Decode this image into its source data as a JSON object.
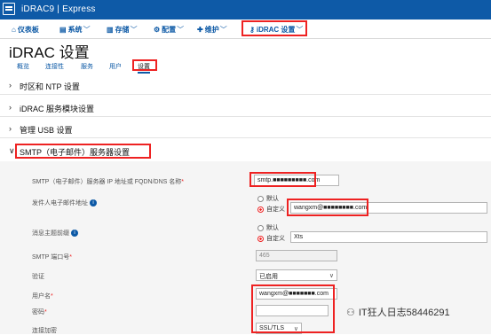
{
  "app": {
    "brand": "iDRAC9 | Express"
  },
  "nav": {
    "dashboard": {
      "label": "仪表板",
      "icon": "home-icon"
    },
    "system": {
      "label": "系统",
      "icon": "server-icon"
    },
    "storage": {
      "label": "存储",
      "icon": "database-icon"
    },
    "config": {
      "label": "配置",
      "icon": "wrench-icon"
    },
    "maintenance": {
      "label": "维护",
      "icon": "tools-icon"
    },
    "idrac_settings": {
      "label": "iDRAC 设置",
      "icon": "key-icon"
    }
  },
  "page": {
    "title": "iDRAC 设置"
  },
  "tabs": {
    "overview": "概览",
    "connectivity": "连接性",
    "services": "服务",
    "users": "用户",
    "settings": "设置"
  },
  "sections": {
    "time": "时区和 NTP 设置",
    "service_module": "iDRAC 服务模块设置",
    "usb": "管理 USB 设置",
    "smtp": "SMTP（电子邮件）服务器设置"
  },
  "form": {
    "smtp_server_label": "SMTP（电子邮件）服务器 IP 地址或 FQDN/DNS 名称",
    "smtp_server_value": "smtp.■■■■■■■■■.com",
    "sender_label": "发件人电子邮件地址",
    "sender_default": "默认",
    "sender_custom": "自定义",
    "sender_value": "wangxm@■■■■■■■■.com",
    "subject_label": "消息主题前缀",
    "subject_default": "默认",
    "subject_custom": "自定义",
    "subject_value": "Xts",
    "port_label": "SMTP 端口号",
    "port_value": "465",
    "auth_label": "验证",
    "auth_value": "已启用",
    "username_label": "用户名",
    "username_value": "wangxm@■■■■■■■.com",
    "password_label": "密码",
    "password_value": "",
    "encryption_label": "连接加密",
    "encryption_value": "SSL/TLS"
  },
  "watermark": {
    "text": "IT狂人日志58446291",
    "icon": "wechat-icon"
  }
}
